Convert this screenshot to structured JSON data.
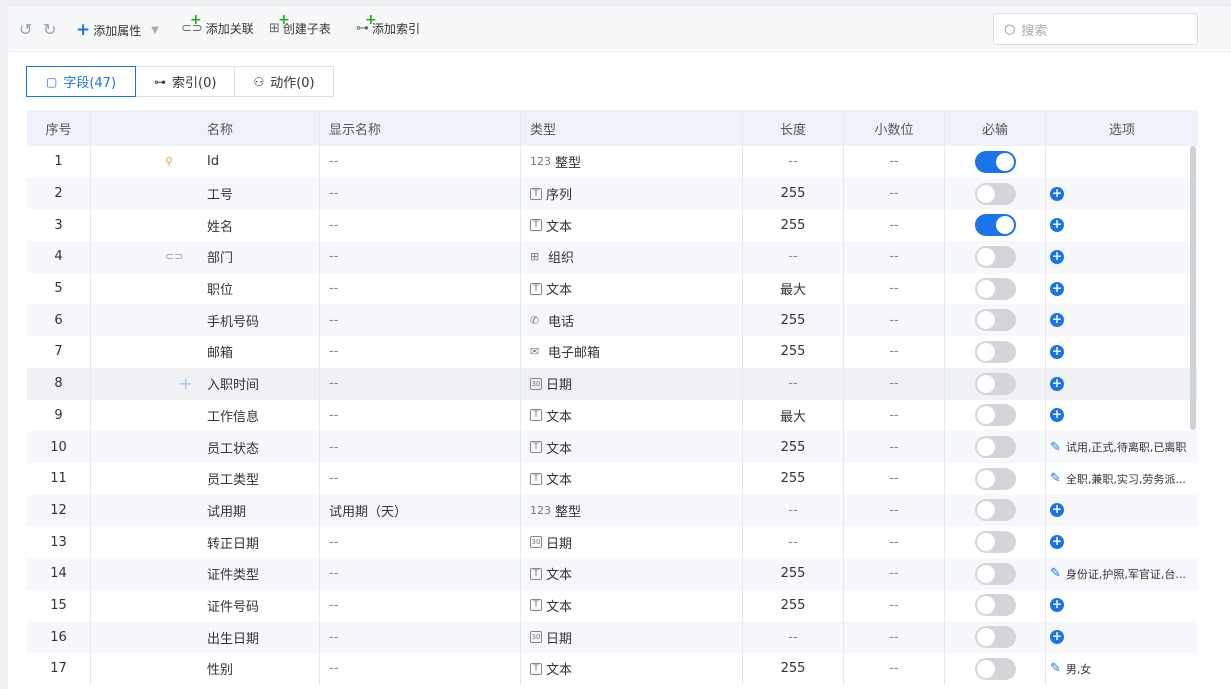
{
  "toolbar": {
    "add_attr": "添加属性",
    "add_link": "添加关联",
    "create_sub": "创建子表",
    "add_index": "添加索引",
    "search_placeholder": "搜索"
  },
  "tabs": [
    {
      "label": "字段(47)"
    },
    {
      "label": "索引(0)"
    },
    {
      "label": "动作(0)"
    }
  ],
  "columns": [
    "序号",
    "名称",
    "显示名称",
    "类型",
    "长度",
    "小数位",
    "必输",
    "选项"
  ],
  "rows": [
    {
      "no": "1",
      "name": "Id",
      "display": "--",
      "type": "整型",
      "type_icon": "123",
      "length": "--",
      "decimal": "--",
      "required": true,
      "lead": "key-icon",
      "option": ""
    },
    {
      "no": "2",
      "name": "工号",
      "display": "--",
      "type": "序列",
      "type_icon": "T",
      "length": "255",
      "decimal": "--",
      "required": false,
      "lead": "",
      "option": "add"
    },
    {
      "no": "3",
      "name": "姓名",
      "display": "--",
      "type": "文本",
      "type_icon": "T",
      "length": "255",
      "decimal": "--",
      "required": true,
      "lead": "",
      "option": "add"
    },
    {
      "no": "4",
      "name": "部门",
      "display": "--",
      "type": "组织",
      "type_icon": "⊞",
      "length": "--",
      "decimal": "--",
      "required": false,
      "lead": "link-icon",
      "option": "add"
    },
    {
      "no": "5",
      "name": "职位",
      "display": "--",
      "type": "文本",
      "type_icon": "T",
      "length": "最大",
      "decimal": "--",
      "required": false,
      "lead": "",
      "option": "add"
    },
    {
      "no": "6",
      "name": "手机号码",
      "display": "--",
      "type": "电话",
      "type_icon": "✆",
      "length": "255",
      "decimal": "--",
      "required": false,
      "lead": "",
      "option": "add"
    },
    {
      "no": "7",
      "name": "邮箱",
      "display": "--",
      "type": "电子邮箱",
      "type_icon": "✉",
      "length": "255",
      "decimal": "--",
      "required": false,
      "lead": "",
      "option": "add"
    },
    {
      "no": "8",
      "name": "入职时间",
      "display": "--",
      "type": "日期",
      "type_icon": "30",
      "length": "--",
      "decimal": "--",
      "required": false,
      "lead": "plus-icon",
      "option": "add"
    },
    {
      "no": "9",
      "name": "工作信息",
      "display": "--",
      "type": "文本",
      "type_icon": "T",
      "length": "最大",
      "decimal": "--",
      "required": false,
      "lead": "",
      "option": "add"
    },
    {
      "no": "10",
      "name": "员工状态",
      "display": "--",
      "type": "文本",
      "type_icon": "T",
      "length": "255",
      "decimal": "--",
      "required": false,
      "lead": "",
      "option": "试用,正式,待离职,已离职"
    },
    {
      "no": "11",
      "name": "员工类型",
      "display": "--",
      "type": "文本",
      "type_icon": "T",
      "length": "255",
      "decimal": "--",
      "required": false,
      "lead": "",
      "option": "全职,兼职,实习,劳务派..."
    },
    {
      "no": "12",
      "name": "试用期",
      "display": "试用期（天）",
      "type": "整型",
      "type_icon": "123",
      "length": "--",
      "decimal": "--",
      "required": false,
      "lead": "",
      "option": "add"
    },
    {
      "no": "13",
      "name": "转正日期",
      "display": "--",
      "type": "日期",
      "type_icon": "30",
      "length": "--",
      "decimal": "--",
      "required": false,
      "lead": "",
      "option": "add"
    },
    {
      "no": "14",
      "name": "证件类型",
      "display": "--",
      "type": "文本",
      "type_icon": "T",
      "length": "255",
      "decimal": "--",
      "required": false,
      "lead": "",
      "option": "身份证,护照,军官证,台..."
    },
    {
      "no": "15",
      "name": "证件号码",
      "display": "--",
      "type": "文本",
      "type_icon": "T",
      "length": "255",
      "decimal": "--",
      "required": false,
      "lead": "",
      "option": "add"
    },
    {
      "no": "16",
      "name": "出生日期",
      "display": "--",
      "type": "日期",
      "type_icon": "30",
      "length": "--",
      "decimal": "--",
      "required": false,
      "lead": "",
      "option": "add"
    },
    {
      "no": "17",
      "name": "性别",
      "display": "--",
      "type": "文本",
      "type_icon": "T",
      "length": "255",
      "decimal": "--",
      "required": false,
      "lead": "",
      "option": "男,女"
    }
  ]
}
